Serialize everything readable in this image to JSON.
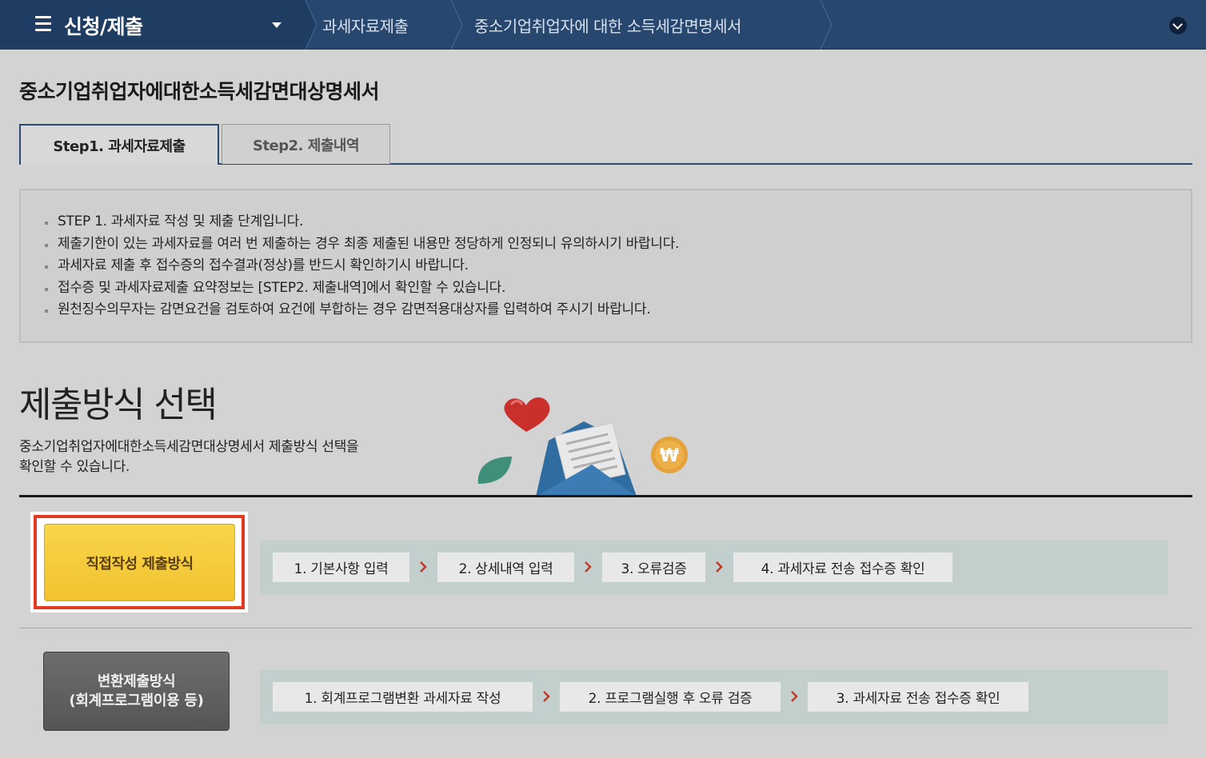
{
  "topbar": {
    "menu_title": "신청/제출",
    "breadcrumbs": [
      "과세자료제출",
      "중소기업취업자에 대한 소득세감면명세서"
    ]
  },
  "page_title": "중소기업취업자에대한소득세감면대상명세서",
  "tabs": [
    {
      "label": "Step1.  과세자료제출",
      "active": true
    },
    {
      "label": "Step2.  제출내역",
      "active": false
    }
  ],
  "notices": [
    "STEP 1. 과세자료 작성 및 제출 단계입니다.",
    "제출기한이 있는 과세자료를 여러 번 제출하는 경우 최종 제출된 내용만 정당하게 인정되니 유의하시기 바랍니다.",
    "과세자료 제출 후 접수증의 접수결과(정상)를 반드시 확인하기시 바랍니다.",
    "접수증 및 과세자료제출 요약정보는 [STEP2. 제출내역]에서 확인할 수 있습니다.",
    "원천징수의무자는 감면요건을 검토하여 요건에 부합하는 경우 감면적용대상자를 입력하여 주시기 바랍니다."
  ],
  "section": {
    "title": "제출방식 선택",
    "desc_line1": "중소기업취업자에대한소득세감면대상명세서 제출방식 선택을",
    "desc_line2": "확인할 수 있습니다."
  },
  "methods": {
    "direct": {
      "label": "직접작성 제출방식",
      "steps": [
        "1. 기본사항 입력",
        "2. 상세내역 입력",
        "3. 오류검증",
        "4. 과세자료 전송 접수증 확인"
      ]
    },
    "convert": {
      "label_line1": "변환제출방식",
      "label_line2": "(회계프로그램이용 등)",
      "steps": [
        "1. 회계프로그램변환 과세자료 작성",
        "2. 프로그램실행 후 오류 검증",
        "3. 과세자료 전송 접수증 확인"
      ]
    }
  },
  "colors": {
    "topbar": "#27476f",
    "accent_yellow": "#f5c93a",
    "highlight_red": "#e03a22",
    "step_arrow": "#c0392b"
  }
}
